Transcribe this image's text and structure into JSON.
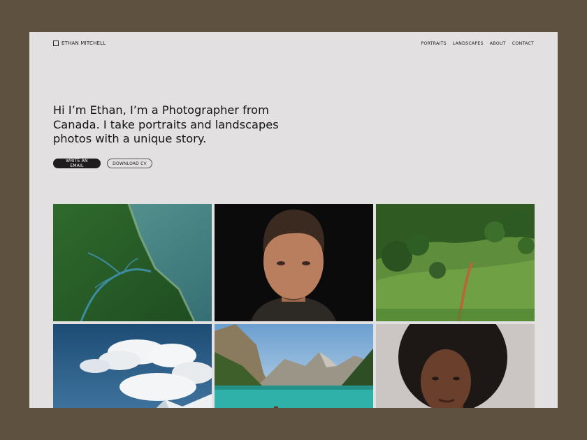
{
  "brand": {
    "name": "ETHAN MITCHELL"
  },
  "nav": {
    "items": [
      {
        "label": "PORTRAITS"
      },
      {
        "label": "LANDSCAPES"
      },
      {
        "label": "ABOUT"
      },
      {
        "label": "CONTACT"
      }
    ]
  },
  "hero": {
    "headline": "Hi I’m Ethan, I’m a Photographer from Canada. I take portraits and landscapes photos with a unique story."
  },
  "buttons": {
    "email_label": "WRITE AN EMAIL",
    "cv_label": "DOWNLOAD CV"
  },
  "colors": {
    "frame": "#5e513f",
    "page": "#e2e0e1",
    "text": "#141414",
    "primary_button": "#1e1c1d"
  }
}
